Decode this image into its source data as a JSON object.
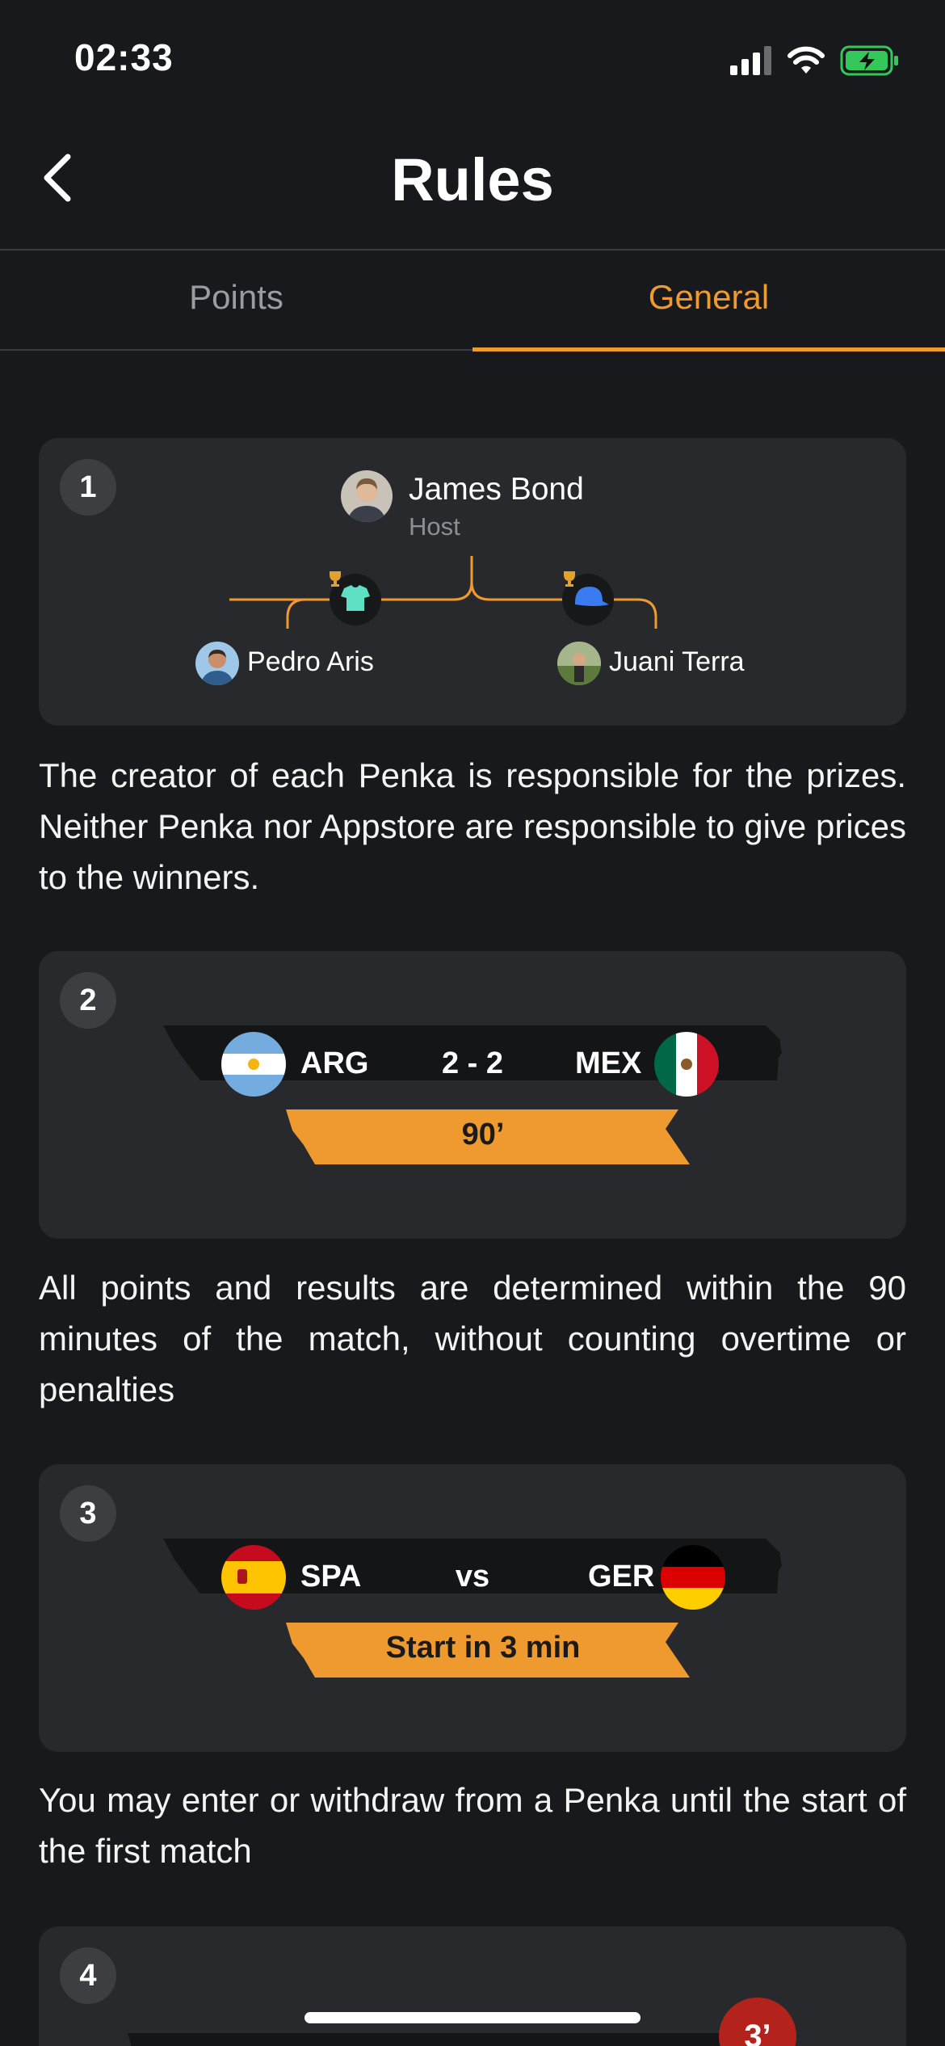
{
  "status": {
    "time": "02:33"
  },
  "header": {
    "title": "Rules"
  },
  "tabs": [
    {
      "label": "Points",
      "active": false
    },
    {
      "label": "General",
      "active": true
    }
  ],
  "colors": {
    "accent": "#ef9a2f",
    "background": "#18191c",
    "card": "#27292c"
  },
  "rules": [
    {
      "number": "1",
      "host": {
        "name": "James Bond",
        "role": "Host"
      },
      "players": [
        {
          "name": "Pedro Aris"
        },
        {
          "name": "Juani Terra"
        }
      ],
      "text": "The creator of each Penka is responsible for the prizes. Neither Penka nor Appstore are responsible to give prices to the winners."
    },
    {
      "number": "2",
      "match": {
        "home": "ARG",
        "score": "2 - 2",
        "away": "MEX",
        "ribbon": "90’"
      },
      "text": "All points and results are determined within the 90 minutes of the match, without counting overtime or penalties"
    },
    {
      "number": "3",
      "match": {
        "home": "SPA",
        "score": "vs",
        "away": "GER",
        "ribbon": "Start in 3 min"
      },
      "text": "You may enter or withdraw from a Penka until the start of the first match"
    },
    {
      "number": "4",
      "badge": "3’"
    }
  ]
}
